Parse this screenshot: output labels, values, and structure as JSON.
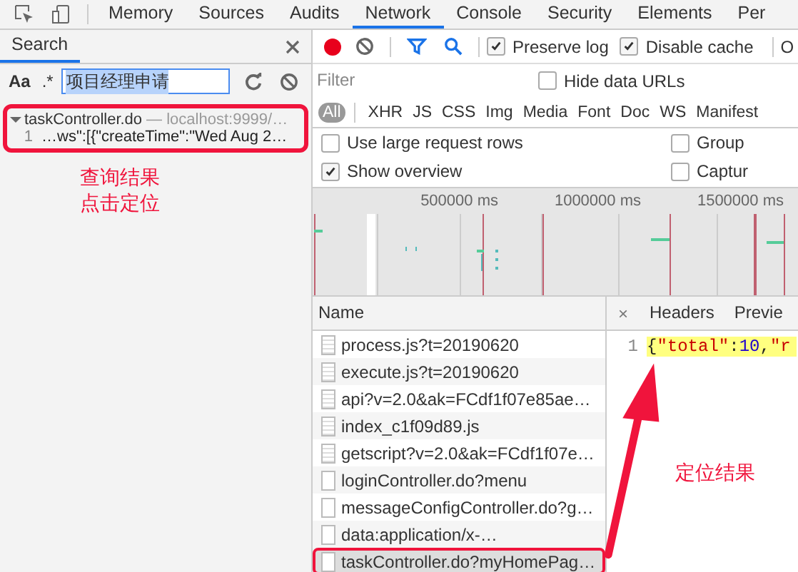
{
  "main_tabs": [
    {
      "label": "Memory",
      "selected": false
    },
    {
      "label": "Sources",
      "selected": false
    },
    {
      "label": "Audits",
      "selected": false
    },
    {
      "label": "Network",
      "selected": true
    },
    {
      "label": "Console",
      "selected": false
    },
    {
      "label": "Security",
      "selected": false
    },
    {
      "label": "Elements",
      "selected": false
    },
    {
      "label": "Per",
      "selected": false
    }
  ],
  "search_panel": {
    "title": "Search",
    "case_toggle": "Aa",
    "regex_toggle": ".*",
    "query": "项目经理申请",
    "results": [
      {
        "file": "taskController.do",
        "location": "— localhost:9999/…",
        "expanded": true,
        "annotated": true,
        "matches": [
          {
            "line": "1",
            "text": "…ws\":[{\"createTime\":\"Wed Aug 2…"
          }
        ]
      }
    ],
    "annotation": [
      "查询结果",
      "点击定位"
    ]
  },
  "toolbar": {
    "recording": true,
    "options": [
      {
        "label": "Preserve log",
        "checked": true
      },
      {
        "label": "Disable cache",
        "checked": true
      }
    ],
    "cut_label": "O"
  },
  "filter": {
    "placeholder": "Filter",
    "hide_data_urls": {
      "label": "Hide data URLs",
      "checked": false
    }
  },
  "type_filters": [
    {
      "label": "All",
      "selected": true
    },
    {
      "label": "XHR",
      "selected": false
    },
    {
      "label": "JS",
      "selected": false
    },
    {
      "label": "CSS",
      "selected": false
    },
    {
      "label": "Img",
      "selected": false
    },
    {
      "label": "Media",
      "selected": false
    },
    {
      "label": "Font",
      "selected": false
    },
    {
      "label": "Doc",
      "selected": false
    },
    {
      "label": "WS",
      "selected": false
    },
    {
      "label": "Manifest",
      "selected": false
    }
  ],
  "settings": [
    {
      "label": "Use large request rows",
      "checked": false
    },
    {
      "label": "Group",
      "checked": false
    },
    {
      "label": "Show overview",
      "checked": true
    },
    {
      "label": "Captur",
      "checked": false
    }
  ],
  "overview": {
    "ticks": [
      "500000 ms",
      "1000000 ms",
      "1500000 ms"
    ]
  },
  "requests": {
    "column": "Name",
    "rows": [
      {
        "name": "process.js?t=20190620",
        "kind": "script",
        "selected": false,
        "annotated": false
      },
      {
        "name": "execute.js?t=20190620",
        "kind": "script",
        "selected": false,
        "annotated": false
      },
      {
        "name": "api?v=2.0&ak=FCdf1f07e85ae…",
        "kind": "script",
        "selected": false,
        "annotated": false
      },
      {
        "name": "index_c1f09d89.js",
        "kind": "script",
        "selected": false,
        "annotated": false
      },
      {
        "name": "getscript?v=2.0&ak=FCdf1f07e…",
        "kind": "script",
        "selected": false,
        "annotated": false
      },
      {
        "name": "loginController.do?menu",
        "kind": "document",
        "selected": false,
        "annotated": false
      },
      {
        "name": "messageConfigController.do?g…",
        "kind": "document",
        "selected": false,
        "annotated": false
      },
      {
        "name": "data:application/x-…",
        "kind": "document",
        "selected": false,
        "annotated": false
      },
      {
        "name": "taskController.do?myHomePag…",
        "kind": "document",
        "selected": true,
        "annotated": true
      }
    ]
  },
  "detail": {
    "close": "×",
    "tabs": [
      {
        "label": "Headers",
        "selected": false
      },
      {
        "label": "Previe",
        "selected": false
      }
    ],
    "line": "1",
    "code": [
      {
        "text": "{",
        "kind": "punct"
      },
      {
        "text": "\"total\"",
        "kind": "string"
      },
      {
        "text": ":",
        "kind": "punct"
      },
      {
        "text": "10",
        "kind": "number"
      },
      {
        "text": ",",
        "kind": "punct"
      },
      {
        "text": "\"r",
        "kind": "string"
      }
    ],
    "annotation": "定位结果"
  }
}
